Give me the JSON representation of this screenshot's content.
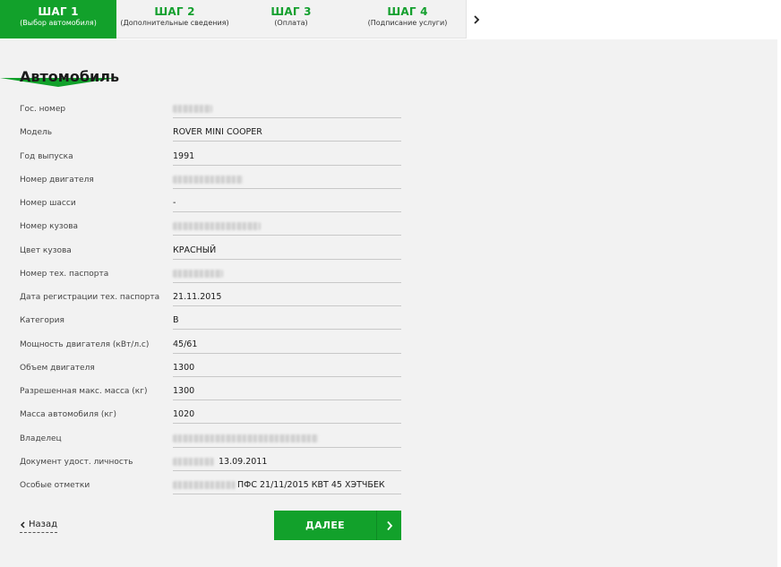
{
  "steps": [
    {
      "title": "ШАГ 1",
      "subtitle": "(Выбор автомобиля)"
    },
    {
      "title": "ШАГ 2",
      "subtitle": "(Дополнительные сведения)"
    },
    {
      "title": "ШАГ 3",
      "subtitle": "(Оплата)"
    },
    {
      "title": "ШАГ 4",
      "subtitle": "(Подписание услуги)"
    }
  ],
  "section_title": "Автомобиль",
  "fields": [
    {
      "label": "Гос. номер",
      "value": ""
    },
    {
      "label": "Модель",
      "value": "ROVER MINI COOPER"
    },
    {
      "label": "Год выпуска",
      "value": "1991"
    },
    {
      "label": "Номер двигателя",
      "value": ""
    },
    {
      "label": "Номер шасси",
      "value": "-"
    },
    {
      "label": "Номер кузова",
      "value": ""
    },
    {
      "label": "Цвет кузова",
      "value": "КРАСНЫЙ"
    },
    {
      "label": "Номер тех. паспорта",
      "value": ""
    },
    {
      "label": "Дата регистрации тех. паспорта",
      "value": "21.11.2015"
    },
    {
      "label": "Категория",
      "value": "B"
    },
    {
      "label": "Мощность двигателя (кВт/л.с)",
      "value": "45/61"
    },
    {
      "label": "Объем двигателя",
      "value": "1300"
    },
    {
      "label": "Разрешенная макс. масса (кг)",
      "value": "1300"
    },
    {
      "label": "Масса автомобиля (кг)",
      "value": "1020"
    },
    {
      "label": "Владелец",
      "value": ""
    },
    {
      "label": "Документ удост. личность",
      "value": "13.09.2011"
    },
    {
      "label": "Особые отметки",
      "value": "ПФС 21/11/2015 КВТ 45 ХЭТЧБЕК"
    }
  ],
  "back_label": "Назад",
  "next_label": "ДАЛЕЕ",
  "colors": {
    "accent": "#12a12b",
    "panel": "#f2f2f2"
  }
}
